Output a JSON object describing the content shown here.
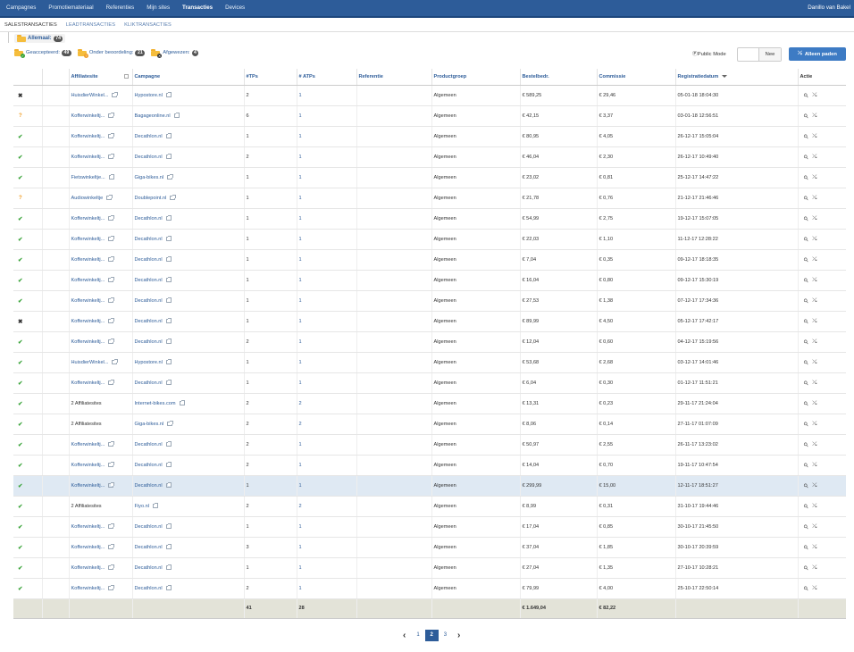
{
  "topnav": {
    "items": [
      {
        "label": "Campagnes"
      },
      {
        "label": "Promotiemateriaal"
      },
      {
        "label": "Referenties"
      },
      {
        "label": "Mijn sites"
      },
      {
        "label": "Transacties",
        "active": true
      },
      {
        "label": "Devices"
      }
    ],
    "user": "Danillo van Bakel"
  },
  "subtabs": [
    {
      "label": "SALESTRANSACTIES",
      "active": true
    },
    {
      "label": "LEADTRANSACTIES"
    },
    {
      "label": "KLIKTRANSACTIES"
    }
  ],
  "folders": {
    "all": {
      "label": "Allemaal:",
      "count": "74"
    },
    "filters": [
      {
        "label": "Geaccepteerd:",
        "count": "49",
        "status": "accepted",
        "color": "#3aa43a"
      },
      {
        "label": "Onder beoordeling:",
        "count": "21",
        "status": "pending",
        "color": "#f09d25"
      },
      {
        "label": "Afgewezen:",
        "count": "4",
        "status": "rejected",
        "color": "#333333"
      }
    ]
  },
  "public_mode": {
    "label": "ⓅPublic Mode",
    "value": "Nee"
  },
  "paths_button": {
    "label": "Alleen paden"
  },
  "table": {
    "columns": [
      "",
      "",
      "Affiliatesite",
      "Campagne",
      "#TPs",
      "# ATPs",
      "Referentie",
      "Productgroep",
      "Bestelbedr.",
      "Commissie",
      "Registratiedatum",
      "Actie"
    ],
    "rows": [
      {
        "status": "rejected",
        "device": "mobile",
        "site": "HuisdierWinkel...",
        "campaign": "Hypostore.nl",
        "tps": "2",
        "atps": "1",
        "product": "Algemeen",
        "amount": "€ 589,25",
        "commission": "€ 29,46",
        "date": "05-01-18 18:04:30"
      },
      {
        "status": "pending",
        "device": "desktop",
        "site": "Kofferwinkeltj...",
        "campaign": "Bagageonline.nl",
        "tps": "6",
        "atps": "1",
        "product": "Algemeen",
        "amount": "€ 42,15",
        "commission": "€ 3,37",
        "date": "03-01-18 12:56:51"
      },
      {
        "status": "accepted",
        "device": "mobile",
        "site": "Kofferwinkeltj...",
        "campaign": "Decathlon.nl",
        "tps": "1",
        "atps": "1",
        "product": "Algemeen",
        "amount": "€ 80,95",
        "commission": "€ 4,05",
        "date": "26-12-17 15:05:04"
      },
      {
        "status": "accepted",
        "device": "desktop",
        "site": "Kofferwinkeltj...",
        "campaign": "Decathlon.nl",
        "tps": "2",
        "atps": "1",
        "product": "Algemeen",
        "amount": "€ 46,04",
        "commission": "€ 2,30",
        "date": "26-12-17 10:49:40"
      },
      {
        "status": "accepted",
        "device": "desktop",
        "site": "Fietswinkeltje...",
        "campaign": "Giga-bikes.nl",
        "tps": "1",
        "atps": "1",
        "product": "Algemeen",
        "amount": "€ 23,02",
        "commission": "€ 0,81",
        "date": "25-12-17 14:47:22"
      },
      {
        "status": "pending",
        "device": "desktop",
        "site": "Audiowinkeltje",
        "campaign": "Doublepoint.nl",
        "tps": "1",
        "atps": "1",
        "product": "Algemeen",
        "amount": "€ 21,78",
        "commission": "€ 0,76",
        "date": "21-12-17 21:46:46"
      },
      {
        "status": "accepted",
        "device": "desktop",
        "site": "Kofferwinkeltj...",
        "campaign": "Decathlon.nl",
        "tps": "1",
        "atps": "1",
        "product": "Algemeen",
        "amount": "€ 54,99",
        "commission": "€ 2,75",
        "date": "19-12-17 15:07:05"
      },
      {
        "status": "accepted",
        "device": "desktop",
        "site": "Kofferwinkeltj...",
        "campaign": "Decathlon.nl",
        "tps": "1",
        "atps": "1",
        "product": "Algemeen",
        "amount": "€ 22,03",
        "commission": "€ 1,10",
        "date": "11-12-17 12:28:22"
      },
      {
        "status": "accepted",
        "device": "desktop",
        "site": "Kofferwinkeltj...",
        "campaign": "Decathlon.nl",
        "tps": "1",
        "atps": "1",
        "product": "Algemeen",
        "amount": "€ 7,04",
        "commission": "€ 0,35",
        "date": "09-12-17 18:18:35"
      },
      {
        "status": "accepted",
        "device": "desktop",
        "site": "Kofferwinkeltj...",
        "campaign": "Decathlon.nl",
        "tps": "1",
        "atps": "1",
        "product": "Algemeen",
        "amount": "€ 16,04",
        "commission": "€ 0,80",
        "date": "09-12-17 15:30:19"
      },
      {
        "status": "accepted",
        "device": "mobile",
        "site": "Kofferwinkeltj...",
        "campaign": "Decathlon.nl",
        "tps": "1",
        "atps": "1",
        "product": "Algemeen",
        "amount": "€ 27,53",
        "commission": "€ 1,38",
        "date": "07-12-17 17:34:36"
      },
      {
        "status": "rejected",
        "device": "desktop",
        "site": "Kofferwinkeltj...",
        "campaign": "Decathlon.nl",
        "tps": "1",
        "atps": "1",
        "product": "Algemeen",
        "amount": "€ 89,99",
        "commission": "€ 4,50",
        "date": "05-12-17 17:42:17"
      },
      {
        "status": "accepted",
        "device": "desktop",
        "site": "Kofferwinkeltj...",
        "campaign": "Decathlon.nl",
        "tps": "2",
        "atps": "1",
        "product": "Algemeen",
        "amount": "€ 12,04",
        "commission": "€ 0,60",
        "date": "04-12-17 15:19:56"
      },
      {
        "status": "accepted",
        "device": "mobile",
        "site": "HuisdierWinkel...",
        "campaign": "Hypostore.nl",
        "tps": "1",
        "atps": "1",
        "product": "Algemeen",
        "amount": "€ 53,68",
        "commission": "€ 2,68",
        "date": "03-12-17 14:01:46"
      },
      {
        "status": "accepted",
        "device": "desktop",
        "site": "Kofferwinkeltj...",
        "campaign": "Decathlon.nl",
        "tps": "1",
        "atps": "1",
        "product": "Algemeen",
        "amount": "€ 6,04",
        "commission": "€ 0,30",
        "date": "01-12-17 11:51:21"
      },
      {
        "status": "accepted",
        "device": "desktop",
        "site": "2 Affiliatesites",
        "site_plain": true,
        "campaign": "Internet-bikes.com",
        "tps": "2",
        "atps": "2",
        "product": "Algemeen",
        "amount": "€ 13,31",
        "commission": "€ 0,23",
        "date": "29-11-17 21:24:04"
      },
      {
        "status": "accepted",
        "device": "desktop",
        "site": "2 Affiliatesites",
        "site_plain": true,
        "campaign": "Giga-bikes.nl",
        "tps": "2",
        "atps": "2",
        "product": "Algemeen",
        "amount": "€ 8,06",
        "commission": "€ 0,14",
        "date": "27-11-17 01:07:09"
      },
      {
        "status": "accepted",
        "device": "desktop",
        "site": "Kofferwinkeltj...",
        "campaign": "Decathlon.nl",
        "tps": "2",
        "atps": "1",
        "product": "Algemeen",
        "amount": "€ 50,97",
        "commission": "€ 2,55",
        "date": "26-11-17 13:23:02"
      },
      {
        "status": "accepted",
        "device": "desktop",
        "site": "Kofferwinkeltj...",
        "campaign": "Decathlon.nl",
        "tps": "2",
        "atps": "1",
        "product": "Algemeen",
        "amount": "€ 14,04",
        "commission": "€ 0,70",
        "date": "19-11-17 10:47:54"
      },
      {
        "status": "accepted",
        "device": "mobile",
        "site": "Kofferwinkeltj...",
        "campaign": "Decathlon.nl",
        "tps": "1",
        "atps": "1",
        "product": "Algemeen",
        "amount": "€ 299,99",
        "commission": "€ 15,00",
        "date": "12-11-17 18:51:27",
        "highlight": true
      },
      {
        "status": "accepted",
        "device": "desktop",
        "site": "2 Affiliatesites",
        "site_plain": true,
        "campaign": "Fiyo.nl",
        "tps": "2",
        "atps": "2",
        "product": "Algemeen",
        "amount": "€ 8,99",
        "commission": "€ 0,31",
        "date": "31-10-17 19:44:46"
      },
      {
        "status": "accepted",
        "device": "desktop",
        "site": "Kofferwinkeltj...",
        "campaign": "Decathlon.nl",
        "tps": "1",
        "atps": "1",
        "product": "Algemeen",
        "amount": "€ 17,04",
        "commission": "€ 0,85",
        "date": "30-10-17 21:45:50"
      },
      {
        "status": "accepted",
        "device": "desktop",
        "site": "Kofferwinkeltj...",
        "campaign": "Decathlon.nl",
        "tps": "3",
        "atps": "1",
        "product": "Algemeen",
        "amount": "€ 37,04",
        "commission": "€ 1,85",
        "date": "30-10-17 20:39:59"
      },
      {
        "status": "accepted",
        "device": "desktop",
        "site": "Kofferwinkeltj...",
        "campaign": "Decathlon.nl",
        "tps": "1",
        "atps": "1",
        "product": "Algemeen",
        "amount": "€ 27,04",
        "commission": "€ 1,35",
        "date": "27-10-17 10:28:21"
      },
      {
        "status": "accepted",
        "device": "mobile",
        "site": "Kofferwinkeltj...",
        "campaign": "Decathlon.nl",
        "tps": "2",
        "atps": "1",
        "product": "Algemeen",
        "amount": "€ 79,99",
        "commission": "€ 4,00",
        "date": "25-10-17 22:50:14"
      }
    ],
    "totals": {
      "tps": "41",
      "atps": "28",
      "amount": "€ 1.649,04",
      "commission": "€ 82,22"
    }
  },
  "pagination": {
    "pages": [
      "1",
      "2",
      "3"
    ],
    "current": "2"
  },
  "colors": {
    "accent": "#2d5c99",
    "topbar": "#2d5c99",
    "accepted": "#3aa43a",
    "pending": "#f09d25",
    "rejected": "#333333",
    "highlight_row": "#dfe9f3",
    "totals_row": "#e3e3d8"
  }
}
